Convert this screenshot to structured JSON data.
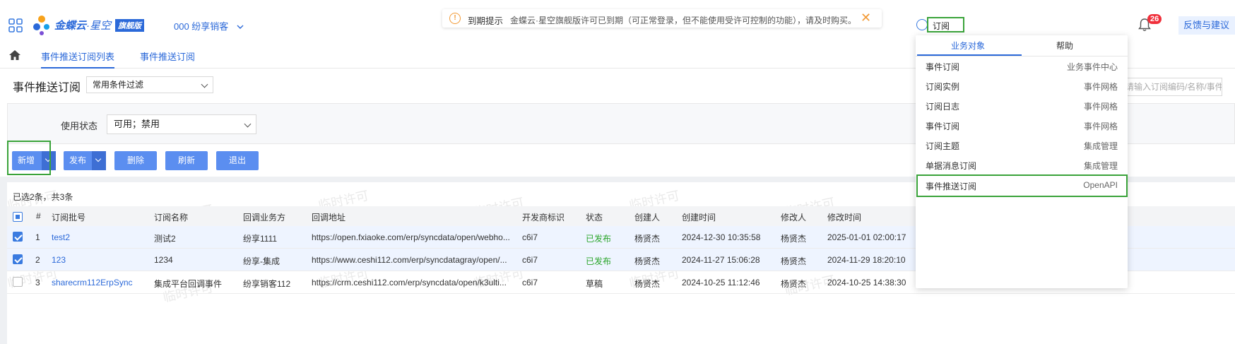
{
  "header": {
    "logo_text": "金蝶云",
    "logo_sub": "·星空",
    "logo_badge": "旗舰版",
    "tenant": "000 纷享销客",
    "notice_title": "到期提示",
    "notice_text": "金蝶云·星空旗舰版许可已到期（可正常登录，但不能使用受许可控制的功能），请及时购买。",
    "search_value": "订阅",
    "bell_count": "26",
    "feedback": "反馈与建议",
    "colors": {
      "brand": "#2b69d9",
      "warning": "#f29a36",
      "badge": "#f0303b",
      "highlight": "#3aa33a"
    }
  },
  "tabs": [
    {
      "label": "事件推送订阅列表",
      "active": true
    },
    {
      "label": "事件推送订阅",
      "active": false
    }
  ],
  "page": {
    "title": "事件推送订阅",
    "filter_select": "常用条件过滤",
    "right_search_placeholder": "请输入订阅编码/名称/事件编码"
  },
  "filter": {
    "status_label": "使用状态",
    "status_value": "可用；禁用"
  },
  "toolbar": {
    "new": "新增",
    "publish": "发布",
    "delete": "删除",
    "refresh": "刷新",
    "exit": "退出"
  },
  "selection_info": "已选2条，共3条",
  "table": {
    "columns": [
      "#",
      "订阅批号",
      "订阅名称",
      "回调业务方",
      "回调地址",
      "开发商标识",
      "状态",
      "创建人",
      "创建时间",
      "修改人",
      "修改时间"
    ],
    "rows": [
      {
        "checked": true,
        "index": "1",
        "batch": "test2",
        "name": "测试2",
        "party": "纷享1111",
        "url": "https://open.fxiaoke.com/erp/syncdata/open/webho...",
        "dev": "c6i7",
        "status": "已发布",
        "creator": "杨贤杰",
        "created": "2024-12-30 10:35:58",
        "modifier": "杨贤杰",
        "modified": "2025-01-01 02:00:17"
      },
      {
        "checked": true,
        "index": "2",
        "batch": "123",
        "name": "1234",
        "party": "纷享-集成",
        "url": "https://www.ceshi112.com/erp/syncdatagray/open/...",
        "dev": "c6i7",
        "status": "已发布",
        "creator": "杨贤杰",
        "created": "2024-11-27 15:06:28",
        "modifier": "杨贤杰",
        "modified": "2024-11-29 18:20:10"
      },
      {
        "checked": false,
        "index": "3",
        "batch": "sharecrm112ErpSync",
        "name": "集成平台回调事件",
        "party": "纷享销客112",
        "url": "https://crm.ceshi112.com/erp/syncdata/open/k3ulti...",
        "dev": "c6i7",
        "status": "草稿",
        "creator": "杨贤杰",
        "created": "2024-10-25 11:12:46",
        "modifier": "杨贤杰",
        "modified": "2024-10-25 14:38:30"
      }
    ]
  },
  "dropdown": {
    "tabs": [
      "业务对象",
      "帮助"
    ],
    "items": [
      {
        "label": "事件订阅",
        "category": "业务事件中心"
      },
      {
        "label": "订阅实例",
        "category": "事件网格"
      },
      {
        "label": "订阅日志",
        "category": "事件网格"
      },
      {
        "label": "事件订阅",
        "category": "事件网格"
      },
      {
        "label": "订阅主题",
        "category": "集成管理"
      },
      {
        "label": "单据消息订阅",
        "category": "集成管理"
      },
      {
        "label": "事件推送订阅",
        "category": "OpenAPI"
      }
    ]
  },
  "watermark": "临时许可"
}
